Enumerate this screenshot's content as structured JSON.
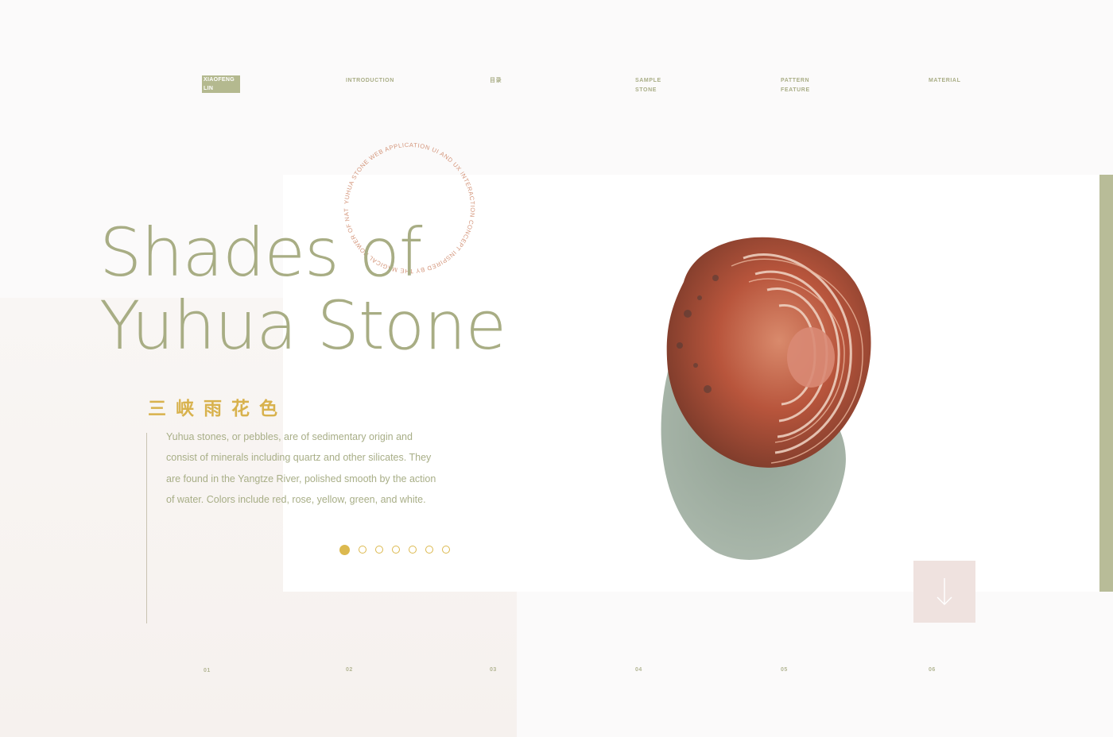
{
  "nav": {
    "logo_line1": "XIAOFENG",
    "logo_line2": "LIN",
    "items": [
      {
        "label": "INTRODUCTION"
      },
      {
        "label": "目录"
      },
      {
        "label": "SAMPLE\nSTONE"
      },
      {
        "label": "PATTERN\nFEATURE"
      },
      {
        "label": "MATERIAL"
      }
    ]
  },
  "hero": {
    "title_line1": "Shades of",
    "title_line2": "Yuhua Stone",
    "circle_text": "YUHUA STONE WEB APPLICATION UI AND UX INTERACTION CONCEPT INSPIRED BY THE MAGICAL POWER OF NATURE",
    "cn_title": "三峡雨花色",
    "description": "Yuhua stones, or pebbles, are of sedimentary origin and consist of minerals including quartz and other silicates. They are found in the Yangtze River, polished smooth by the action of water. Colors include red, rose, yellow, green, and white.",
    "slide_count": 7,
    "active_slide": 1
  },
  "footer_numbers": [
    "01",
    "02",
    "03",
    "04",
    "05",
    "06"
  ],
  "colors": {
    "accent_green": "#a8ad84",
    "accent_gold": "#d8b24d",
    "side_bar": "#b8bc98",
    "button_pink": "#efe2df",
    "stone_red": "#b8553c"
  },
  "icons": {
    "down": "arrow-down-icon"
  }
}
